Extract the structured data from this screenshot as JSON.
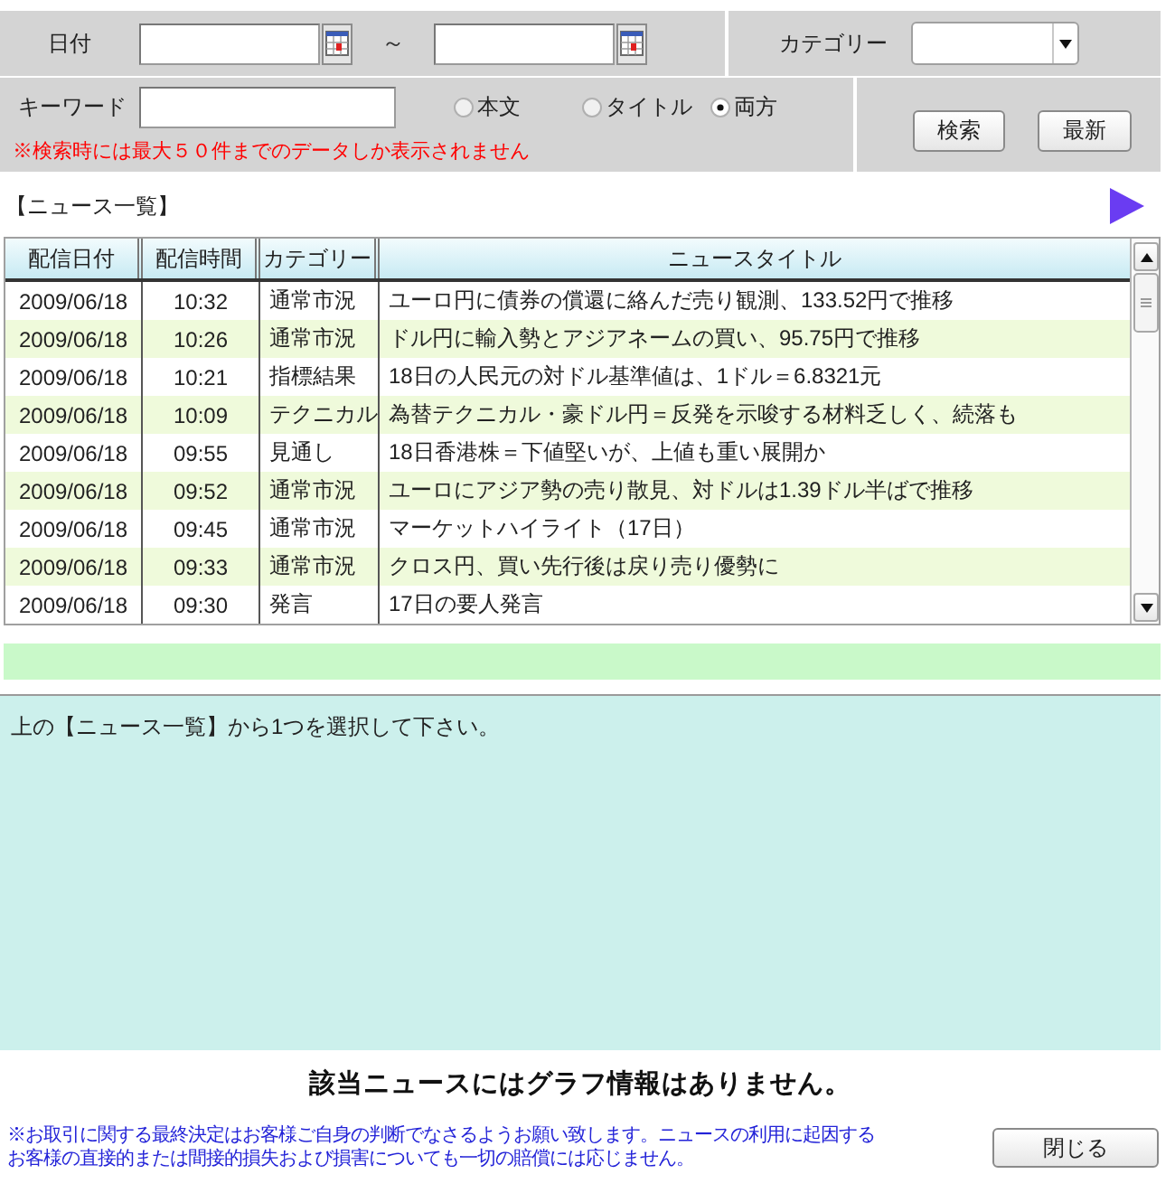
{
  "search_form": {
    "date_label": "日付",
    "range_separator": "～",
    "category_label": "カテゴリー",
    "keyword_label": "キーワード",
    "search_scope": [
      {
        "label": "本文",
        "selected": false
      },
      {
        "label": "タイトル",
        "selected": false
      },
      {
        "label": "両方",
        "selected": true
      }
    ],
    "warning": "※検索時には最大５０件までのデータしか表示されません",
    "buttons": [
      "検索",
      "最新"
    ]
  },
  "news_list": {
    "title": "【ニュース一覧】",
    "columns": [
      "配信日付",
      "配信時間",
      "カテゴリー",
      "ニュースタイトル"
    ],
    "rows": [
      {
        "date": "2009/06/18",
        "time": "10:32",
        "category": "通常市況",
        "title": "ユーロ円に債券の償還に絡んだ売り観測、133.52円で推移",
        "selected": false
      },
      {
        "date": "2009/06/18",
        "time": "10:26",
        "category": "通常市況",
        "title": "ドル円に輸入勢とアジアネームの買い、95.75円で推移",
        "selected": false
      },
      {
        "date": "2009/06/18",
        "time": "10:21",
        "category": "指標結果",
        "title": "18日の人民元の対ドル基準値は、1ドル＝6.8321元",
        "selected": false
      },
      {
        "date": "2009/06/18",
        "time": "10:09",
        "category": "テクニカル",
        "title": "為替テクニカル・豪ドル円＝反発を示唆する材料乏しく、続落も",
        "selected": false
      },
      {
        "date": "2009/06/18",
        "time": "09:55",
        "category": "見通し",
        "title": "18日香港株＝下値堅いが、上値も重い展開か",
        "selected": false
      },
      {
        "date": "2009/06/18",
        "time": "09:52",
        "category": "通常市況",
        "title": "ユーロにアジア勢の売り散見、対ドルは1.39ドル半ばで推移",
        "selected": false
      },
      {
        "date": "2009/06/18",
        "time": "09:45",
        "category": "通常市況",
        "title": "マーケットハイライト（17日）",
        "selected": false
      },
      {
        "date": "2009/06/18",
        "time": "09:33",
        "category": "通常市況",
        "title": "クロス円、買い先行後は戻り売り優勢に",
        "selected": false
      },
      {
        "date": "2009/06/18",
        "time": "09:30",
        "category": "発言",
        "title": "17日の要人発言",
        "selected": false
      }
    ]
  },
  "detail": {
    "message": "上の【ニュース一覧】から1つを選択して下さい。"
  },
  "graph_message": "該当ニュースにはグラフ情報はありません。",
  "disclaimer": [
    "※お取引に関する最終決定はお客様ご自身の判断でなさるようお願い致します。ニュースの利用に起因する",
    "お客様の直接的または間接的損失および損害についても一切の賠償には応じません。"
  ],
  "close_button": "閉じる"
}
